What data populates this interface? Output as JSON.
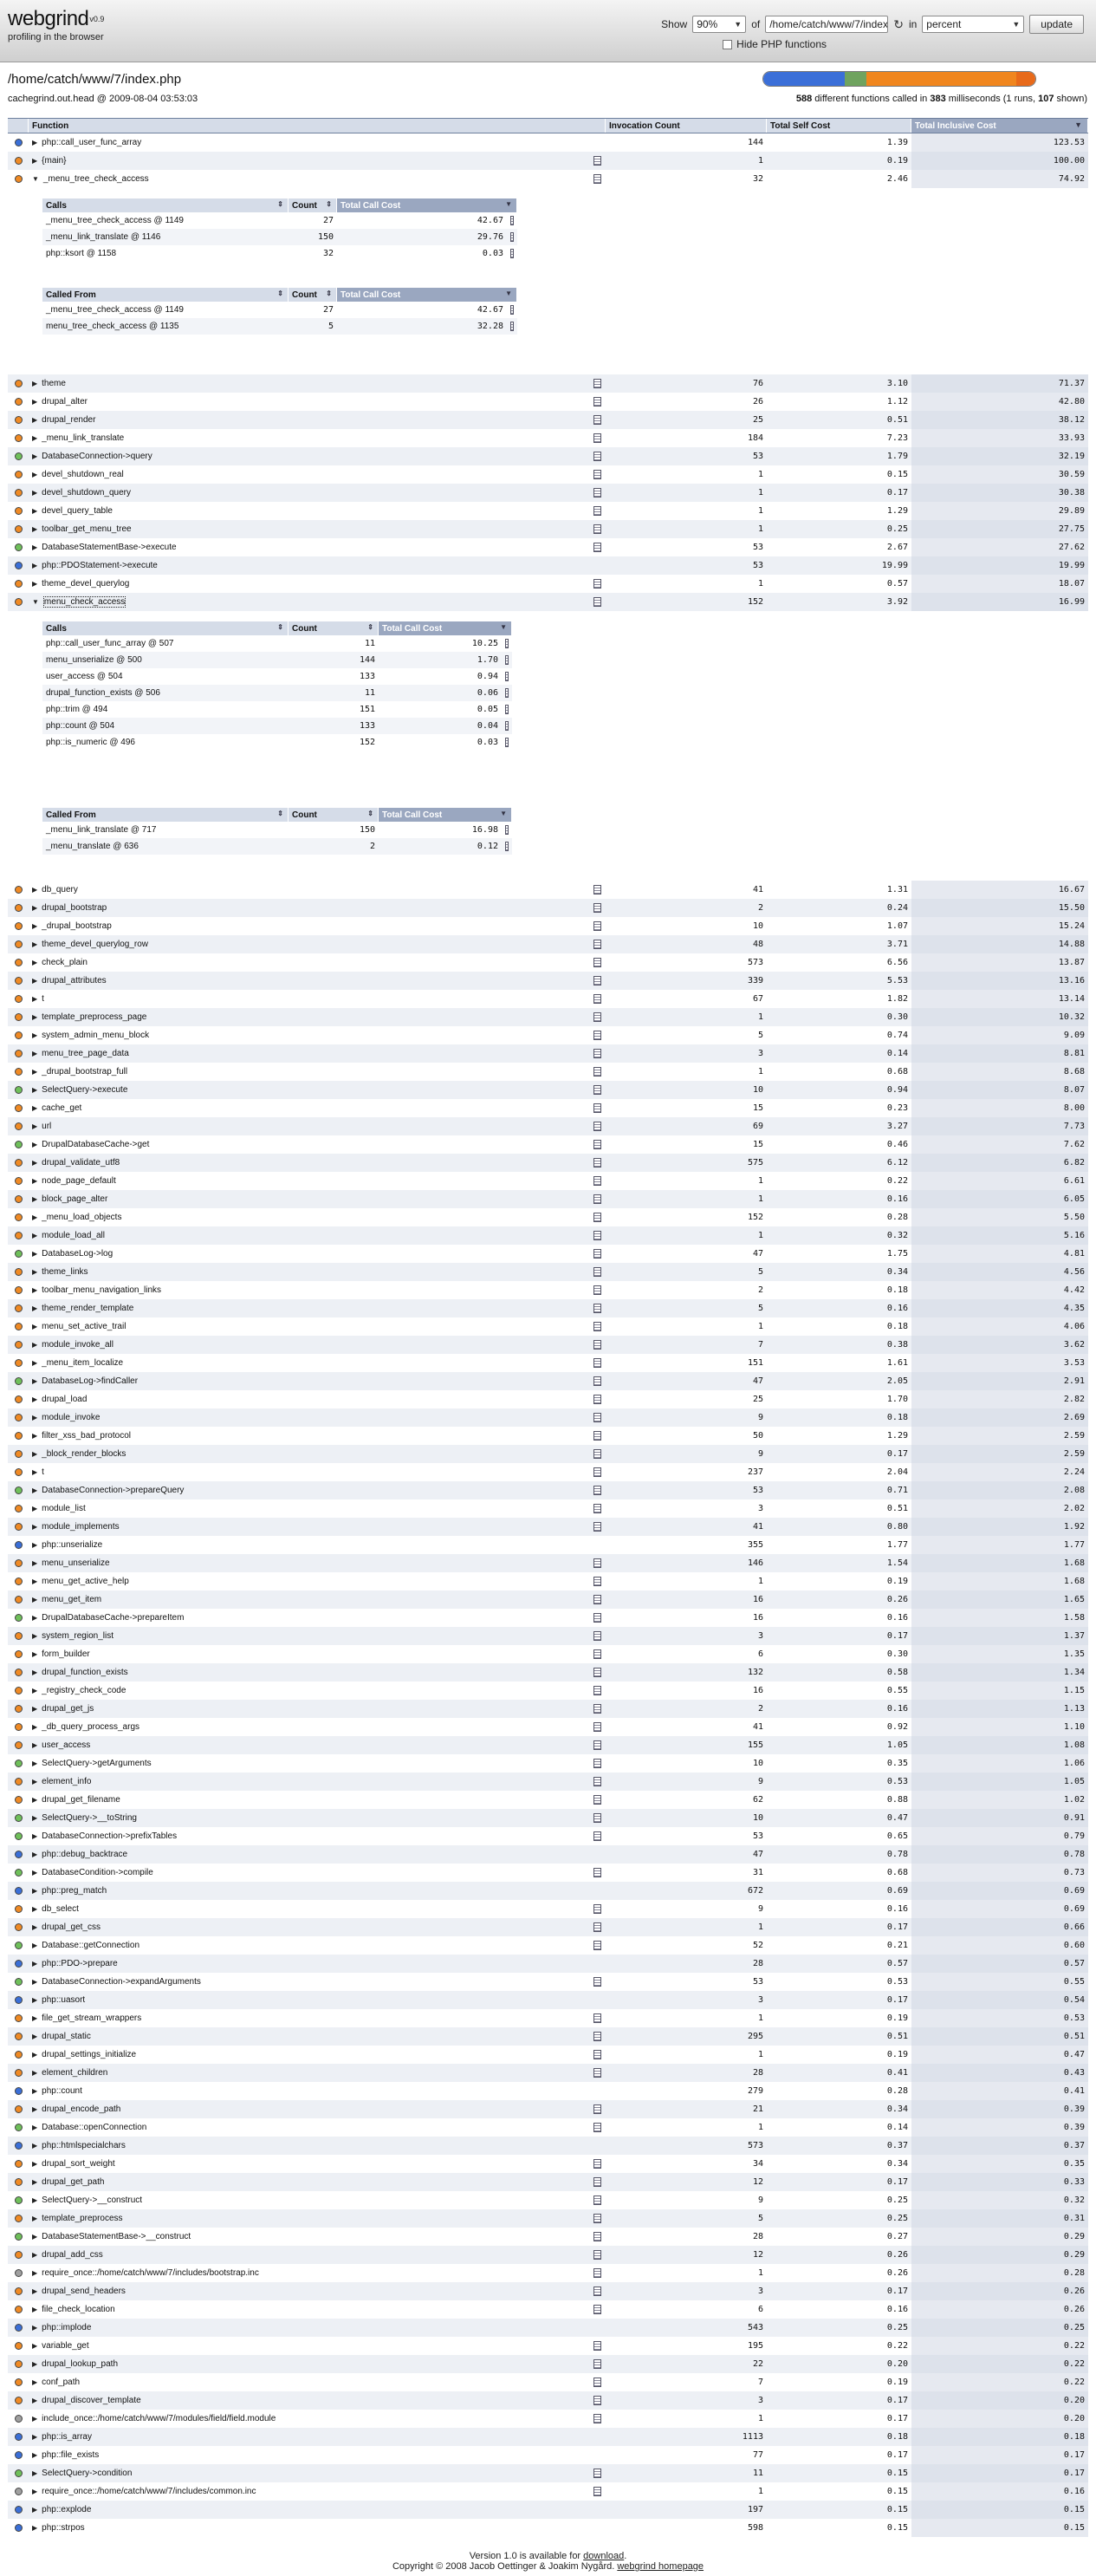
{
  "app": {
    "name": "webgrind",
    "version": "v0.9",
    "tagline": "profiling in the browser"
  },
  "controls": {
    "show_label": "Show",
    "show_value": "90%",
    "of_label": "of",
    "file_value": "/home/catch/www/7/index.p",
    "in_label": "in",
    "unit_value": "percent",
    "update_label": "update",
    "hide_php_label": "Hide PHP functions"
  },
  "info": {
    "path": "/home/catch/www/7/index.php",
    "dump": "cachegrind.out.head @ 2009-08-04 03:53:03",
    "fn_count": "588",
    "summary_mid": " different functions called in ",
    "ms": "383",
    "summary_end": " milliseconds (1 runs, ",
    "shown": "107",
    "summary_tail": " shown)"
  },
  "costbar_colors": [
    "#3b6fd8",
    "#6fa35f",
    "#f0861e",
    "#e86a1a"
  ],
  "costbar_values": [
    0.3,
    0.08,
    0.55,
    0.07
  ],
  "colors": {
    "internal": "#3a6fd8",
    "include": "#a0a0a0",
    "class": "#6fc05a",
    "procedural": "#f08a24"
  },
  "table_headers": [
    "Function",
    "Invocation Count",
    "Total Self Cost",
    "Total Inclusive Cost"
  ],
  "sub_headers_calls": [
    "Calls",
    "Count",
    "Total Call Cost"
  ],
  "sub_headers_from": [
    "Called From",
    "Count",
    "Total Call Cost"
  ],
  "rows": [
    {
      "name": "php::call_user_func_array",
      "type": "internal",
      "file": false,
      "ic": "144",
      "sc": "1.39",
      "tc": "123.53"
    },
    {
      "name": "{main}",
      "type": "procedural",
      "file": true,
      "ic": "1",
      "sc": "0.19",
      "tc": "100.00"
    },
    {
      "name": "_menu_tree_check_access",
      "type": "procedural",
      "file": true,
      "ic": "32",
      "sc": "2.46",
      "tc": "74.92",
      "expanded": 0
    },
    {
      "name": "theme",
      "type": "procedural",
      "file": true,
      "ic": "76",
      "sc": "3.10",
      "tc": "71.37"
    },
    {
      "name": "drupal_alter",
      "type": "procedural",
      "file": true,
      "ic": "26",
      "sc": "1.12",
      "tc": "42.80"
    },
    {
      "name": "drupal_render",
      "type": "procedural",
      "file": true,
      "ic": "25",
      "sc": "0.51",
      "tc": "38.12"
    },
    {
      "name": "_menu_link_translate",
      "type": "procedural",
      "file": true,
      "ic": "184",
      "sc": "7.23",
      "tc": "33.93"
    },
    {
      "name": "DatabaseConnection->query",
      "type": "class",
      "file": true,
      "ic": "53",
      "sc": "1.79",
      "tc": "32.19"
    },
    {
      "name": "devel_shutdown_real",
      "type": "procedural",
      "file": true,
      "ic": "1",
      "sc": "0.15",
      "tc": "30.59"
    },
    {
      "name": "devel_shutdown_query",
      "type": "procedural",
      "file": true,
      "ic": "1",
      "sc": "0.17",
      "tc": "30.38"
    },
    {
      "name": "devel_query_table",
      "type": "procedural",
      "file": true,
      "ic": "1",
      "sc": "1.29",
      "tc": "29.89"
    },
    {
      "name": "toolbar_get_menu_tree",
      "type": "procedural",
      "file": true,
      "ic": "1",
      "sc": "0.25",
      "tc": "27.75"
    },
    {
      "name": "DatabaseStatementBase->execute",
      "type": "class",
      "file": true,
      "ic": "53",
      "sc": "2.67",
      "tc": "27.62"
    },
    {
      "name": "php::PDOStatement->execute",
      "type": "internal",
      "file": false,
      "ic": "53",
      "sc": "19.99",
      "tc": "19.99"
    },
    {
      "name": "theme_devel_querylog",
      "type": "procedural",
      "file": true,
      "ic": "1",
      "sc": "0.57",
      "tc": "18.07"
    },
    {
      "name": "menu_check_access",
      "type": "procedural",
      "file": true,
      "ic": "152",
      "sc": "3.92",
      "tc": "16.99",
      "expanded": 1,
      "focused": true
    },
    {
      "name": "db_query",
      "type": "procedural",
      "file": true,
      "ic": "41",
      "sc": "1.31",
      "tc": "16.67"
    },
    {
      "name": "drupal_bootstrap",
      "type": "procedural",
      "file": true,
      "ic": "2",
      "sc": "0.24",
      "tc": "15.50"
    },
    {
      "name": "_drupal_bootstrap",
      "type": "procedural",
      "file": true,
      "ic": "10",
      "sc": "1.07",
      "tc": "15.24"
    },
    {
      "name": "theme_devel_querylog_row",
      "type": "procedural",
      "file": true,
      "ic": "48",
      "sc": "3.71",
      "tc": "14.88"
    },
    {
      "name": "check_plain",
      "type": "procedural",
      "file": true,
      "ic": "573",
      "sc": "6.56",
      "tc": "13.87"
    },
    {
      "name": "drupal_attributes",
      "type": "procedural",
      "file": true,
      "ic": "339",
      "sc": "5.53",
      "tc": "13.16"
    },
    {
      "name": "t",
      "type": "procedural",
      "file": true,
      "ic": "67",
      "sc": "1.82",
      "tc": "13.14"
    },
    {
      "name": "template_preprocess_page",
      "type": "procedural",
      "file": true,
      "ic": "1",
      "sc": "0.30",
      "tc": "10.32"
    },
    {
      "name": "system_admin_menu_block",
      "type": "procedural",
      "file": true,
      "ic": "5",
      "sc": "0.74",
      "tc": "9.09"
    },
    {
      "name": "menu_tree_page_data",
      "type": "procedural",
      "file": true,
      "ic": "3",
      "sc": "0.14",
      "tc": "8.81"
    },
    {
      "name": "_drupal_bootstrap_full",
      "type": "procedural",
      "file": true,
      "ic": "1",
      "sc": "0.68",
      "tc": "8.68"
    },
    {
      "name": "SelectQuery->execute",
      "type": "class",
      "file": true,
      "ic": "10",
      "sc": "0.94",
      "tc": "8.07"
    },
    {
      "name": "cache_get",
      "type": "procedural",
      "file": true,
      "ic": "15",
      "sc": "0.23",
      "tc": "8.00"
    },
    {
      "name": "url",
      "type": "procedural",
      "file": true,
      "ic": "69",
      "sc": "3.27",
      "tc": "7.73"
    },
    {
      "name": "DrupalDatabaseCache->get",
      "type": "class",
      "file": true,
      "ic": "15",
      "sc": "0.46",
      "tc": "7.62"
    },
    {
      "name": "drupal_validate_utf8",
      "type": "procedural",
      "file": true,
      "ic": "575",
      "sc": "6.12",
      "tc": "6.82"
    },
    {
      "name": "node_page_default",
      "type": "procedural",
      "file": true,
      "ic": "1",
      "sc": "0.22",
      "tc": "6.61"
    },
    {
      "name": "block_page_alter",
      "type": "procedural",
      "file": true,
      "ic": "1",
      "sc": "0.16",
      "tc": "6.05"
    },
    {
      "name": "_menu_load_objects",
      "type": "procedural",
      "file": true,
      "ic": "152",
      "sc": "0.28",
      "tc": "5.50"
    },
    {
      "name": "module_load_all",
      "type": "procedural",
      "file": true,
      "ic": "1",
      "sc": "0.32",
      "tc": "5.16"
    },
    {
      "name": "DatabaseLog->log",
      "type": "class",
      "file": true,
      "ic": "47",
      "sc": "1.75",
      "tc": "4.81"
    },
    {
      "name": "theme_links",
      "type": "procedural",
      "file": true,
      "ic": "5",
      "sc": "0.34",
      "tc": "4.56"
    },
    {
      "name": "toolbar_menu_navigation_links",
      "type": "procedural",
      "file": true,
      "ic": "2",
      "sc": "0.18",
      "tc": "4.42"
    },
    {
      "name": "theme_render_template",
      "type": "procedural",
      "file": true,
      "ic": "5",
      "sc": "0.16",
      "tc": "4.35"
    },
    {
      "name": "menu_set_active_trail",
      "type": "procedural",
      "file": true,
      "ic": "1",
      "sc": "0.18",
      "tc": "4.06"
    },
    {
      "name": "module_invoke_all",
      "type": "procedural",
      "file": true,
      "ic": "7",
      "sc": "0.38",
      "tc": "3.62"
    },
    {
      "name": "_menu_item_localize",
      "type": "procedural",
      "file": true,
      "ic": "151",
      "sc": "1.61",
      "tc": "3.53"
    },
    {
      "name": "DatabaseLog->findCaller",
      "type": "class",
      "file": true,
      "ic": "47",
      "sc": "2.05",
      "tc": "2.91"
    },
    {
      "name": "drupal_load",
      "type": "procedural",
      "file": true,
      "ic": "25",
      "sc": "1.70",
      "tc": "2.82"
    },
    {
      "name": "module_invoke",
      "type": "procedural",
      "file": true,
      "ic": "9",
      "sc": "0.18",
      "tc": "2.69"
    },
    {
      "name": "filter_xss_bad_protocol",
      "type": "procedural",
      "file": true,
      "ic": "50",
      "sc": "1.29",
      "tc": "2.59"
    },
    {
      "name": "_block_render_blocks",
      "type": "procedural",
      "file": true,
      "ic": "9",
      "sc": "0.17",
      "tc": "2.59"
    },
    {
      "name": "t",
      "type": "procedural",
      "file": true,
      "ic": "237",
      "sc": "2.04",
      "tc": "2.24"
    },
    {
      "name": "DatabaseConnection->prepareQuery",
      "type": "class",
      "file": true,
      "ic": "53",
      "sc": "0.71",
      "tc": "2.08"
    },
    {
      "name": "module_list",
      "type": "procedural",
      "file": true,
      "ic": "3",
      "sc": "0.51",
      "tc": "2.02"
    },
    {
      "name": "module_implements",
      "type": "procedural",
      "file": true,
      "ic": "41",
      "sc": "0.80",
      "tc": "1.92"
    },
    {
      "name": "php::unserialize",
      "type": "internal",
      "file": false,
      "ic": "355",
      "sc": "1.77",
      "tc": "1.77"
    },
    {
      "name": "menu_unserialize",
      "type": "procedural",
      "file": true,
      "ic": "146",
      "sc": "1.54",
      "tc": "1.68"
    },
    {
      "name": "menu_get_active_help",
      "type": "procedural",
      "file": true,
      "ic": "1",
      "sc": "0.19",
      "tc": "1.68"
    },
    {
      "name": "menu_get_item",
      "type": "procedural",
      "file": true,
      "ic": "16",
      "sc": "0.26",
      "tc": "1.65"
    },
    {
      "name": "DrupalDatabaseCache->prepareItem",
      "type": "class",
      "file": true,
      "ic": "16",
      "sc": "0.16",
      "tc": "1.58"
    },
    {
      "name": "system_region_list",
      "type": "procedural",
      "file": true,
      "ic": "3",
      "sc": "0.17",
      "tc": "1.37"
    },
    {
      "name": "form_builder",
      "type": "procedural",
      "file": true,
      "ic": "6",
      "sc": "0.30",
      "tc": "1.35"
    },
    {
      "name": "drupal_function_exists",
      "type": "procedural",
      "file": true,
      "ic": "132",
      "sc": "0.58",
      "tc": "1.34"
    },
    {
      "name": "_registry_check_code",
      "type": "procedural",
      "file": true,
      "ic": "16",
      "sc": "0.55",
      "tc": "1.15"
    },
    {
      "name": "drupal_get_js",
      "type": "procedural",
      "file": true,
      "ic": "2",
      "sc": "0.16",
      "tc": "1.13"
    },
    {
      "name": "_db_query_process_args",
      "type": "procedural",
      "file": true,
      "ic": "41",
      "sc": "0.92",
      "tc": "1.10"
    },
    {
      "name": "user_access",
      "type": "procedural",
      "file": true,
      "ic": "155",
      "sc": "1.05",
      "tc": "1.08"
    },
    {
      "name": "SelectQuery->getArguments",
      "type": "class",
      "file": true,
      "ic": "10",
      "sc": "0.35",
      "tc": "1.06"
    },
    {
      "name": "element_info",
      "type": "procedural",
      "file": true,
      "ic": "9",
      "sc": "0.53",
      "tc": "1.05"
    },
    {
      "name": "drupal_get_filename",
      "type": "procedural",
      "file": true,
      "ic": "62",
      "sc": "0.88",
      "tc": "1.02"
    },
    {
      "name": "SelectQuery->__toString",
      "type": "class",
      "file": true,
      "ic": "10",
      "sc": "0.47",
      "tc": "0.91"
    },
    {
      "name": "DatabaseConnection->prefixTables",
      "type": "class",
      "file": true,
      "ic": "53",
      "sc": "0.65",
      "tc": "0.79"
    },
    {
      "name": "php::debug_backtrace",
      "type": "internal",
      "file": false,
      "ic": "47",
      "sc": "0.78",
      "tc": "0.78"
    },
    {
      "name": "DatabaseCondition->compile",
      "type": "class",
      "file": true,
      "ic": "31",
      "sc": "0.68",
      "tc": "0.73"
    },
    {
      "name": "php::preg_match",
      "type": "internal",
      "file": false,
      "ic": "672",
      "sc": "0.69",
      "tc": "0.69"
    },
    {
      "name": "db_select",
      "type": "procedural",
      "file": true,
      "ic": "9",
      "sc": "0.16",
      "tc": "0.69"
    },
    {
      "name": "drupal_get_css",
      "type": "procedural",
      "file": true,
      "ic": "1",
      "sc": "0.17",
      "tc": "0.66"
    },
    {
      "name": "Database::getConnection",
      "type": "class",
      "file": true,
      "ic": "52",
      "sc": "0.21",
      "tc": "0.60"
    },
    {
      "name": "php::PDO->prepare",
      "type": "internal",
      "file": false,
      "ic": "28",
      "sc": "0.57",
      "tc": "0.57"
    },
    {
      "name": "DatabaseConnection->expandArguments",
      "type": "class",
      "file": true,
      "ic": "53",
      "sc": "0.53",
      "tc": "0.55"
    },
    {
      "name": "php::uasort",
      "type": "internal",
      "file": false,
      "ic": "3",
      "sc": "0.17",
      "tc": "0.54"
    },
    {
      "name": "file_get_stream_wrappers",
      "type": "procedural",
      "file": true,
      "ic": "1",
      "sc": "0.19",
      "tc": "0.53"
    },
    {
      "name": "drupal_static",
      "type": "procedural",
      "file": true,
      "ic": "295",
      "sc": "0.51",
      "tc": "0.51"
    },
    {
      "name": "drupal_settings_initialize",
      "type": "procedural",
      "file": true,
      "ic": "1",
      "sc": "0.19",
      "tc": "0.47"
    },
    {
      "name": "element_children",
      "type": "procedural",
      "file": true,
      "ic": "28",
      "sc": "0.41",
      "tc": "0.43"
    },
    {
      "name": "php::count",
      "type": "internal",
      "file": false,
      "ic": "279",
      "sc": "0.28",
      "tc": "0.41"
    },
    {
      "name": "drupal_encode_path",
      "type": "procedural",
      "file": true,
      "ic": "21",
      "sc": "0.34",
      "tc": "0.39"
    },
    {
      "name": "Database::openConnection",
      "type": "class",
      "file": true,
      "ic": "1",
      "sc": "0.14",
      "tc": "0.39"
    },
    {
      "name": "php::htmlspecialchars",
      "type": "internal",
      "file": false,
      "ic": "573",
      "sc": "0.37",
      "tc": "0.37"
    },
    {
      "name": "drupal_sort_weight",
      "type": "procedural",
      "file": true,
      "ic": "34",
      "sc": "0.34",
      "tc": "0.35"
    },
    {
      "name": "drupal_get_path",
      "type": "procedural",
      "file": true,
      "ic": "12",
      "sc": "0.17",
      "tc": "0.33"
    },
    {
      "name": "SelectQuery->__construct",
      "type": "class",
      "file": true,
      "ic": "9",
      "sc": "0.25",
      "tc": "0.32"
    },
    {
      "name": "template_preprocess",
      "type": "procedural",
      "file": true,
      "ic": "5",
      "sc": "0.25",
      "tc": "0.31"
    },
    {
      "name": "DatabaseStatementBase->__construct",
      "type": "class",
      "file": true,
      "ic": "28",
      "sc": "0.27",
      "tc": "0.29"
    },
    {
      "name": "drupal_add_css",
      "type": "procedural",
      "file": true,
      "ic": "12",
      "sc": "0.26",
      "tc": "0.29"
    },
    {
      "name": "require_once::/home/catch/www/7/includes/bootstrap.inc",
      "type": "include",
      "file": true,
      "ic": "1",
      "sc": "0.26",
      "tc": "0.28"
    },
    {
      "name": "drupal_send_headers",
      "type": "procedural",
      "file": true,
      "ic": "3",
      "sc": "0.17",
      "tc": "0.26"
    },
    {
      "name": "file_check_location",
      "type": "procedural",
      "file": true,
      "ic": "6",
      "sc": "0.16",
      "tc": "0.26"
    },
    {
      "name": "php::implode",
      "type": "internal",
      "file": false,
      "ic": "543",
      "sc": "0.25",
      "tc": "0.25"
    },
    {
      "name": "variable_get",
      "type": "procedural",
      "file": true,
      "ic": "195",
      "sc": "0.22",
      "tc": "0.22"
    },
    {
      "name": "drupal_lookup_path",
      "type": "procedural",
      "file": true,
      "ic": "22",
      "sc": "0.20",
      "tc": "0.22"
    },
    {
      "name": "conf_path",
      "type": "procedural",
      "file": true,
      "ic": "7",
      "sc": "0.19",
      "tc": "0.22"
    },
    {
      "name": "drupal_discover_template",
      "type": "procedural",
      "file": true,
      "ic": "3",
      "sc": "0.17",
      "tc": "0.20"
    },
    {
      "name": "include_once::/home/catch/www/7/modules/field/field.module",
      "type": "include",
      "file": true,
      "ic": "1",
      "sc": "0.17",
      "tc": "0.20"
    },
    {
      "name": "php::is_array",
      "type": "internal",
      "file": false,
      "ic": "1113",
      "sc": "0.18",
      "tc": "0.18"
    },
    {
      "name": "php::file_exists",
      "type": "internal",
      "file": false,
      "ic": "77",
      "sc": "0.17",
      "tc": "0.17"
    },
    {
      "name": "SelectQuery->condition",
      "type": "class",
      "file": true,
      "ic": "11",
      "sc": "0.15",
      "tc": "0.17"
    },
    {
      "name": "require_once::/home/catch/www/7/includes/common.inc",
      "type": "include",
      "file": true,
      "ic": "1",
      "sc": "0.15",
      "tc": "0.16"
    },
    {
      "name": "php::explode",
      "type": "internal",
      "file": false,
      "ic": "197",
      "sc": "0.15",
      "tc": "0.15"
    },
    {
      "name": "php::strpos",
      "type": "internal",
      "file": false,
      "ic": "598",
      "sc": "0.15",
      "tc": "0.15"
    }
  ],
  "expansions": [
    {
      "calls": [
        {
          "name": "_menu_tree_check_access @ 1149",
          "count": "27",
          "cost": "42.67"
        },
        {
          "name": "_menu_link_translate @ 1146",
          "count": "150",
          "cost": "29.76"
        },
        {
          "name": "php::ksort @ 1158",
          "count": "32",
          "cost": "0.03"
        }
      ],
      "from": [
        {
          "name": "_menu_tree_check_access @ 1149",
          "count": "27",
          "cost": "42.67"
        },
        {
          "name": "menu_tree_check_access @ 1135",
          "count": "5",
          "cost": "32.28"
        }
      ]
    },
    {
      "calls": [
        {
          "name": "php::call_user_func_array @ 507",
          "count": "11",
          "cost": "10.25"
        },
        {
          "name": "menu_unserialize @ 500",
          "count": "144",
          "cost": "1.70"
        },
        {
          "name": "user_access @ 504",
          "count": "133",
          "cost": "0.94"
        },
        {
          "name": "drupal_function_exists @ 506",
          "count": "11",
          "cost": "0.06"
        },
        {
          "name": "php::trim @ 494",
          "count": "151",
          "cost": "0.05"
        },
        {
          "name": "php::count @ 504",
          "count": "133",
          "cost": "0.04"
        },
        {
          "name": "php::is_numeric @ 496",
          "count": "152",
          "cost": "0.03"
        }
      ],
      "from": [
        {
          "name": "_menu_link_translate @ 717",
          "count": "150",
          "cost": "16.98"
        },
        {
          "name": "_menu_translate @ 636",
          "count": "2",
          "cost": "0.12"
        }
      ]
    }
  ],
  "footer": {
    "line1_pre": "Version 1.0 is available for ",
    "line1_link": "download",
    "line1_post": ".",
    "line2_pre": "Copyright © 2008 Jacob Oettinger & Joakim Nygård. ",
    "line2_link": "webgrind homepage"
  }
}
